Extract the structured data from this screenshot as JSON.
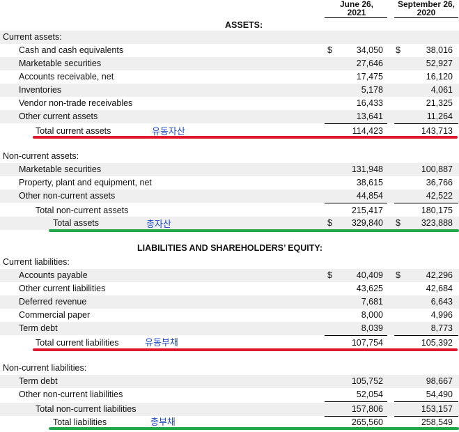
{
  "columns": {
    "col1": "June 26,\n2021",
    "col1_l1": "June 26,",
    "col1_l2": "2021",
    "col2_l1": "September 26,",
    "col2_l2": "2020"
  },
  "assets_heading": "ASSETS:",
  "liab_heading": "LIABILITIES AND SHAREHOLDERS’ EQUITY:",
  "rows": [
    {
      "label": "Current assets:",
      "c1d": "",
      "c1": "",
      "c2d": "",
      "c2": ""
    },
    {
      "label": "Cash and cash equivalents",
      "c1d": "$",
      "c1": "34,050",
      "c2d": "$",
      "c2": "38,016"
    },
    {
      "label": "Marketable securities",
      "c1d": "",
      "c1": "27,646",
      "c2d": "",
      "c2": "52,927"
    },
    {
      "label": "Accounts receivable, net",
      "c1d": "",
      "c1": "17,475",
      "c2d": "",
      "c2": "16,120"
    },
    {
      "label": "Inventories",
      "c1d": "",
      "c1": "5,178",
      "c2d": "",
      "c2": "4,061"
    },
    {
      "label": "Vendor non-trade receivables",
      "c1d": "",
      "c1": "16,433",
      "c2d": "",
      "c2": "21,325"
    },
    {
      "label": "Other current assets",
      "c1d": "",
      "c1": "13,641",
      "c2d": "",
      "c2": "11,264"
    },
    {
      "label": "Total current assets",
      "c1d": "",
      "c1": "114,423",
      "c2d": "",
      "c2": "143,713",
      "note": "유동자산"
    },
    {
      "label": "Non-current assets:",
      "c1d": "",
      "c1": "",
      "c2d": "",
      "c2": ""
    },
    {
      "label": "Marketable securities",
      "c1d": "",
      "c1": "131,948",
      "c2d": "",
      "c2": "100,887"
    },
    {
      "label": "Property, plant and equipment, net",
      "c1d": "",
      "c1": "38,615",
      "c2d": "",
      "c2": "36,766"
    },
    {
      "label": "Other non-current assets",
      "c1d": "",
      "c1": "44,854",
      "c2d": "",
      "c2": "42,522"
    },
    {
      "label": "Total non-current assets",
      "c1d": "",
      "c1": "215,417",
      "c2d": "",
      "c2": "180,175"
    },
    {
      "label": "Total assets",
      "c1d": "$",
      "c1": "329,840",
      "c2d": "$",
      "c2": "323,888",
      "note": "총자산"
    },
    {
      "label": "Current liabilities:",
      "c1d": "",
      "c1": "",
      "c2d": "",
      "c2": ""
    },
    {
      "label": "Accounts payable",
      "c1d": "$",
      "c1": "40,409",
      "c2d": "$",
      "c2": "42,296"
    },
    {
      "label": "Other current liabilities",
      "c1d": "",
      "c1": "43,625",
      "c2d": "",
      "c2": "42,684"
    },
    {
      "label": "Deferred revenue",
      "c1d": "",
      "c1": "7,681",
      "c2d": "",
      "c2": "6,643"
    },
    {
      "label": "Commercial paper",
      "c1d": "",
      "c1": "8,000",
      "c2d": "",
      "c2": "4,996"
    },
    {
      "label": "Term debt",
      "c1d": "",
      "c1": "8,039",
      "c2d": "",
      "c2": "8,773"
    },
    {
      "label": "Total current liabilities",
      "c1d": "",
      "c1": "107,754",
      "c2d": "",
      "c2": "105,392",
      "note": "유동부채"
    },
    {
      "label": "Non-current liabilities:",
      "c1d": "",
      "c1": "",
      "c2d": "",
      "c2": ""
    },
    {
      "label": "Term debt",
      "c1d": "",
      "c1": "105,752",
      "c2d": "",
      "c2": "98,667"
    },
    {
      "label": "Other non-current liabilities",
      "c1d": "",
      "c1": "52,054",
      "c2d": "",
      "c2": "54,490"
    },
    {
      "label": "Total non-current liabilities",
      "c1d": "",
      "c1": "157,806",
      "c2d": "",
      "c2": "153,157"
    },
    {
      "label": "Total liabilities",
      "c1d": "",
      "c1": "265,560",
      "c2d": "",
      "c2": "258,549",
      "note": "총부채"
    }
  ],
  "colors": {
    "shade": "#efefef",
    "annotation_text": "#1f49c8",
    "red_marker": "#e0182d",
    "green_marker": "#22a84a"
  }
}
